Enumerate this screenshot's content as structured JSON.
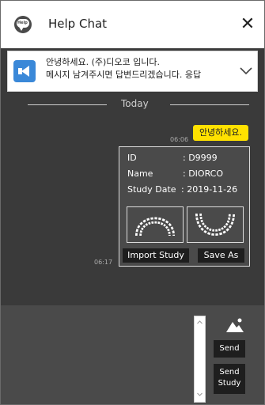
{
  "window": {
    "title": "Help Chat",
    "logo_text": "Help",
    "close_glyph": "✕"
  },
  "notice": {
    "line1": "안녕하세요. (주)디오코 입니다.",
    "line2": "메시지 남겨주시면 답변드리겠습니다. 응답",
    "icon": "megaphone-icon",
    "expand_icon": "chevron-down-icon"
  },
  "chat": {
    "date_divider": "Today",
    "messages": [
      {
        "type": "text",
        "time": "06:06",
        "text": "안녕하세요."
      },
      {
        "type": "study_card",
        "time": "06:17",
        "fields": [
          {
            "label": "ID",
            "value": ": D9999"
          },
          {
            "label": "Name",
            "value": ": DIORCO"
          },
          {
            "label": "Study Date",
            "value": ": 2019-11-26"
          }
        ],
        "thumbnails": [
          "upper-jaw-icon",
          "lower-jaw-icon"
        ],
        "buttons": {
          "import": "Import Study",
          "save": "Save As"
        }
      }
    ]
  },
  "input": {
    "image_icon": "image-icon",
    "send_label": "Send",
    "send_study_line1": "Send",
    "send_study_line2": "Study"
  },
  "colors": {
    "chat_bg": "#3a3a3a",
    "input_bg": "#4a4a4a",
    "bubble": "#ffe100",
    "notice_icon": "#3a88d8",
    "button_bg": "#1e1e1e"
  }
}
